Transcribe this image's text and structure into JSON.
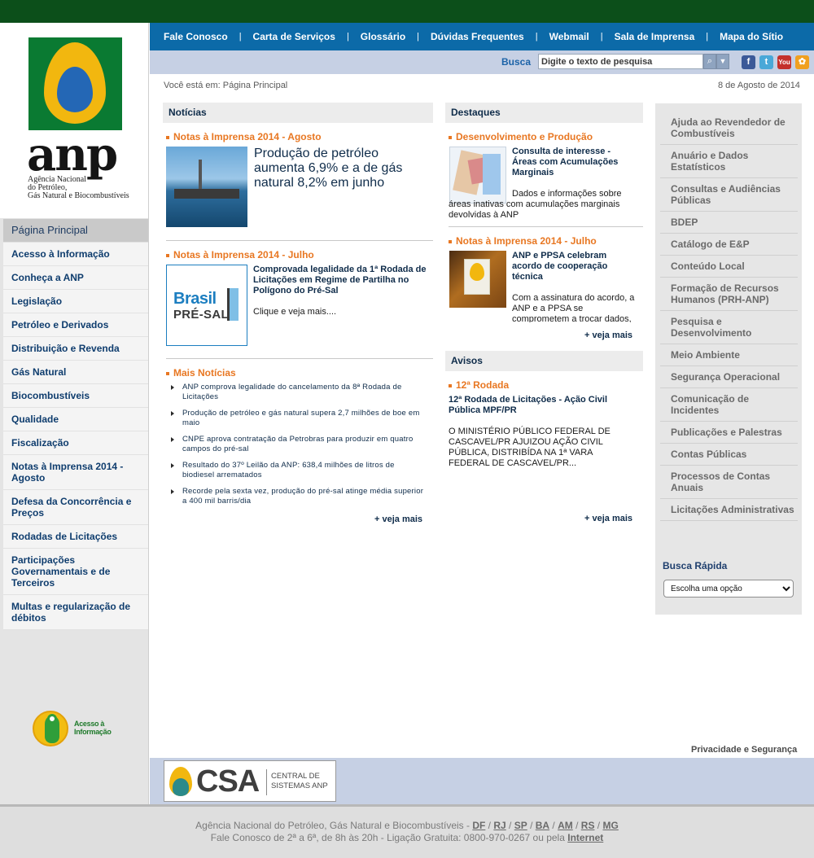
{
  "logo": {
    "word": "anp",
    "subtitle_lines": [
      "Agência Nacional",
      "do Petróleo,",
      "Gás Natural e Biocombustíveis"
    ]
  },
  "top_nav": [
    "Fale Conosco",
    "Carta de Serviços",
    "Glossário",
    "Dúvidas Frequentes",
    "Webmail",
    "Sala de Imprensa",
    "Mapa do Sítio"
  ],
  "search": {
    "label": "Busca",
    "placeholder": "Digite o texto de pesquisa"
  },
  "social": [
    "f",
    "t",
    "You",
    "✿"
  ],
  "breadcrumb": "Você está em: Página Principal",
  "date": "8 de Agosto de 2014",
  "left_nav": [
    "Página Principal",
    "Acesso à Informação",
    "Conheça a ANP",
    "Legislação",
    "Petróleo e Derivados",
    "Distribuição e Revenda",
    "Gás Natural",
    "Biocombustíveis",
    "Qualidade",
    "Fiscalização",
    "Notas à Imprensa 2014 - Agosto",
    "Defesa da Concorrência e Preços",
    "Rodadas de Licitações",
    "Participações Governamentais e de Terceiros",
    "Multas e regularização de débitos"
  ],
  "acesso_badge": {
    "line1": "Acesso à",
    "line2": "Informação"
  },
  "noticias": {
    "header": "Notícias",
    "block1": {
      "category": "Notas à Imprensa 2014 - Agosto",
      "title": "Produção de petróleo aumenta 6,9% e a de gás natural 8,2% em junho"
    },
    "block2": {
      "category": "Notas à Imprensa 2014 - Julho",
      "image_word1": "Brasil",
      "image_word2": "PRÉ-SAL",
      "title": "Comprovada legalidade da 1ª Rodada de Licitações em Regime de Partilha no Polígono do Pré-Sal",
      "link": "Clique e veja mais...."
    },
    "mais": {
      "category": "Mais Notícias",
      "items": [
        "ANP comprova legalidade do cancelamento da 8ª Rodada de Licitações",
        "Produção de petróleo e gás natural supera 2,7 milhões de boe em maio",
        "CNPE aprova contratação da Petrobras para produzir em quatro campos do pré-sal",
        "Resultado do 37º Leilão da ANP: 638,4 milhões de litros de biodiesel arrematados",
        "Recorde pela sexta vez, produção do pré-sal atinge média superior a 400 mil barris/dia"
      ],
      "more": "+ veja mais"
    }
  },
  "destaques": {
    "header": "Destaques",
    "item1": {
      "category": "Desenvolvimento e Produção",
      "title": "Consulta de interesse - Áreas com Acumulações Marginais",
      "text_line1": "Dados e informações sobre",
      "text_rest": "áreas inativas com acumulações marginais devolvidas à ANP"
    },
    "item2": {
      "category": "Notas à Imprensa 2014 - Julho",
      "title": "ANP e PPSA celebram acordo de cooperação técnica",
      "text": "Com a assinatura do acordo, a ANP e a PPSA se comprometem a trocar dados, relatórios e"
    },
    "more": "+ veja mais"
  },
  "avisos": {
    "header": "Avisos",
    "category": "12ª Rodada",
    "title": "12ª Rodada de Licitações - Ação Civil Pública MPF/PR",
    "text": "O MINISTÉRIO PÚBLICO FEDERAL DE CASCAVEL/PR AJUIZOU AÇÃO CIVIL PÚBLICA, DISTRIBÍDA NA 1ª VARA FEDERAL DE CASCAVEL/PR...",
    "more": "+ veja mais"
  },
  "right_menu": [
    "Ajuda ao Revendedor de Combustíveis",
    "Anuário e Dados Estatísticos",
    "Consultas e Audiências Públicas",
    "BDEP",
    "Catálogo de E&P",
    "Conteúdo Local",
    "Formação de Recursos Humanos (PRH-ANP)",
    "Pesquisa e Desenvolvimento",
    "Meio Ambiente",
    "Segurança Operacional",
    "Comunicação de Incidentes",
    "Publicações e Palestras",
    "Contas Públicas",
    "Processos de Contas Anuais",
    "Licitações Administrativas"
  ],
  "busca_rapida": {
    "label": "Busca Rápida",
    "selected": "Escolha uma opção"
  },
  "footer": {
    "privacy": "Privacidade e Segurança",
    "csa_word": "CSA",
    "csa_sub1": "CENTRAL DE",
    "csa_sub2": "SISTEMAS ANP",
    "line1_text": "Agência Nacional do Petróleo, Gás Natural e Biocombustíveis -",
    "offices": [
      "DF",
      "RJ",
      "SP",
      "BA",
      "AM",
      "RS",
      "MG"
    ],
    "line2_text": "Fale Conosco de 2ª a 6ª, de 8h às 20h - Ligação Gratuita: 0800-970-0267 ou pela",
    "line2_link": "Internet"
  },
  "colors": {
    "top_strip": "#0c4f1a",
    "top_nav": "#0c6aa8",
    "search_bar": "#c6d0e4",
    "orange_accent": "#e87722",
    "navy_text": "#0f2c4a"
  }
}
